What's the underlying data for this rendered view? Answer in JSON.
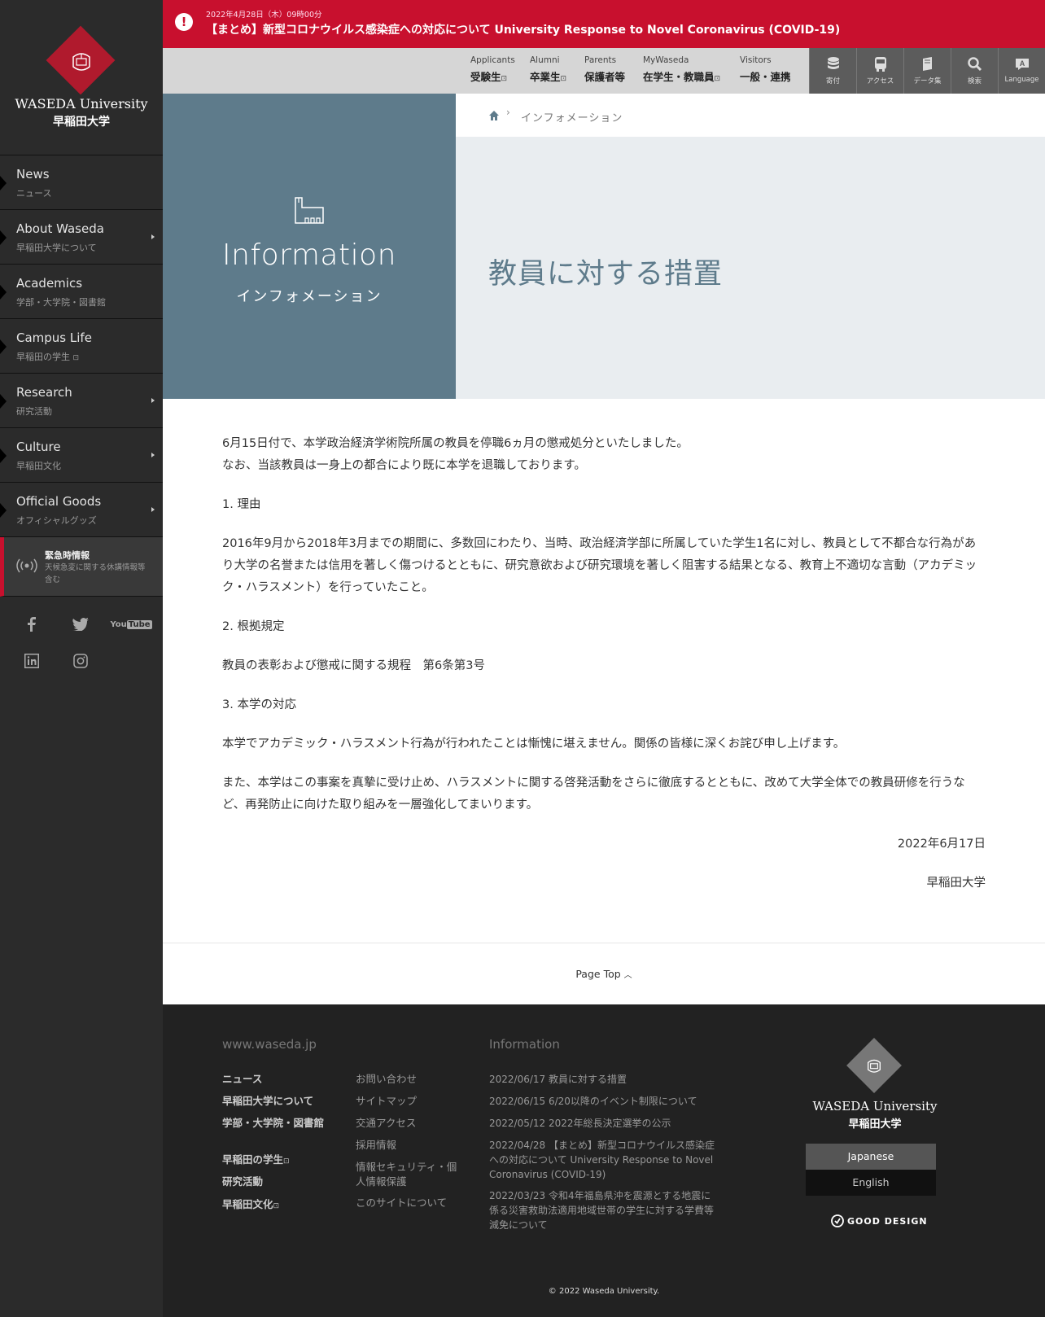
{
  "logo": {
    "en": "WASEDA University",
    "ja": "早稲田大学"
  },
  "sidebar": {
    "items": [
      {
        "en": "News",
        "ja": "ニュース"
      },
      {
        "en": "About Waseda",
        "ja": "早稲田大学について"
      },
      {
        "en": "Academics",
        "ja": "学部・大学院・図書館"
      },
      {
        "en": "Campus Life",
        "ja": "早稲田の学生"
      },
      {
        "en": "Research",
        "ja": "研究活動"
      },
      {
        "en": "Culture",
        "ja": "早稲田文化"
      },
      {
        "en": "Official Goods",
        "ja": "オフィシャルグッズ"
      }
    ],
    "emergency": {
      "title": "緊急時情報",
      "desc": "天候急変に関する休講情報等含む"
    },
    "social_icons": [
      "facebook-icon",
      "twitter-icon",
      "youtube-icon",
      "linkedin-icon",
      "instagram-icon"
    ]
  },
  "alert": {
    "date": "2022年4月28日（木）09時00分",
    "text": "【まとめ】新型コロナウイルス感染症への対応について University Response to Novel Coronavirus (COVID-19)"
  },
  "topnav": {
    "audiences": [
      {
        "en": "Applicants",
        "ja": "受験生"
      },
      {
        "en": "Alumni",
        "ja": "卒業生"
      },
      {
        "en": "Parents",
        "ja": "保護者等"
      },
      {
        "en": "MyWaseda",
        "ja": "在学生・教職員"
      },
      {
        "en": "Visitors",
        "ja": "一般・連携"
      }
    ],
    "utils": [
      {
        "label": "寄付",
        "icon": "coins-icon"
      },
      {
        "label": "アクセス",
        "icon": "bus-icon"
      },
      {
        "label": "データ集",
        "icon": "books-icon"
      },
      {
        "label": "検索",
        "icon": "search-icon"
      },
      {
        "label": "Language",
        "icon": "language-icon"
      }
    ]
  },
  "hero": {
    "title_en": "Information",
    "title_ja": "インフォメーション",
    "breadcrumb_current": "インフォメーション",
    "page_title": "教員に対する措置"
  },
  "article": {
    "p1": "6月15日付で、本学政治経済学術院所属の教員を停職6ヵ月の懲戒処分といたしました。",
    "p2": "なお、当該教員は一身上の都合により既に本学を退職しております。",
    "h1": "1. 理由",
    "p3": "2016年9月から2018年3月までの期間に、多数回にわたり、当時、政治経済学部に所属していた学生1名に対し、教員として不都合な行為があり大学の名誉または信用を著しく傷つけるとともに、研究意欲および研究環境を著しく阻害する結果となる、教育上不適切な言動（アカデミック・ハラスメント）を行っていたこと。",
    "h2": "2. 根拠規定",
    "p4": "教員の表彰および懲戒に関する規程　第6条第3号",
    "h3": "3. 本学の対応",
    "p5": "本学でアカデミック・ハラスメント行為が行われたことは慚愧に堪えません。関係の皆様に深くお詫び申し上げます。",
    "p6": "また、本学はこの事案を真摯に受け止め、ハラスメントに関する啓発活動をさらに徹底するとともに、改めて大学全体での教員研修を行うなど、再発防止に向けた取り組みを一層強化してまいります。",
    "date": "2022年6月17日",
    "signature": "早稲田大学"
  },
  "pagetop": "Page Top",
  "footer": {
    "site_heading": "www.waseda.jp",
    "col1": [
      "ニュース",
      "早稲田大学について",
      "学部・大学院・図書館",
      "早稲田の学生",
      "研究活動",
      "早稲田文化"
    ],
    "col2": [
      "お問い合わせ",
      "サイトマップ",
      "交通アクセス",
      "採用情報",
      "情報セキュリティ・個人情報保護",
      "このサイトについて"
    ],
    "info_heading": "Information",
    "news": [
      "2022/06/17 教員に対する措置",
      "2022/06/15 6/20以降のイベント制限について",
      "2022/05/12 2022年総長決定選挙の公示",
      "2022/04/28 【まとめ】新型コロナウイルス感染症への対応について University Response to Novel Coronavirus (COVID-19)",
      "2022/03/23 令和4年福島県沖を震源とする地震に係る災害救助法適用地域世帯の学生に対する学費等減免について"
    ],
    "lang_ja": "Japanese",
    "lang_en": "English",
    "good_design": "GOOD DESIGN",
    "copyright": "© 2022 Waseda University."
  },
  "colors": {
    "brand_red": "#c8102e",
    "hero_blue": "#5e7b8b",
    "sidebar_bg": "#2b2b2b"
  }
}
